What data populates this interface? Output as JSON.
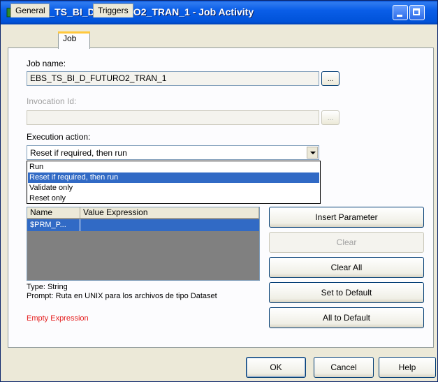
{
  "window": {
    "title": "JOBT_TS_BI_D_FUTURO2_TRAN_1 - Job Activity"
  },
  "tabs": [
    {
      "label": "General"
    },
    {
      "label": "Job"
    },
    {
      "label": "Triggers"
    }
  ],
  "job_name": {
    "label": "Job name:",
    "value": "EBS_TS_BI_D_FUTURO2_TRAN_1",
    "browse_label": "..."
  },
  "invocation": {
    "label": "Invocation Id:",
    "value": "",
    "browse_label": "..."
  },
  "execution": {
    "label": "Execution action:",
    "selected": "Reset if required, then run",
    "options": [
      "Run",
      "Reset if required, then run",
      "Validate only",
      "Reset only"
    ]
  },
  "parameters": {
    "columns": [
      "Name",
      "Value Expression"
    ],
    "rows": [
      {
        "name": "$PRM_P...",
        "value": ""
      }
    ]
  },
  "param_info": {
    "type": "Type: String",
    "prompt": "Prompt: Ruta en UNIX para los archivos de tipo Dataset",
    "error": "Empty Expression"
  },
  "side_buttons": {
    "insert": "Insert Parameter",
    "clear": "Clear",
    "clear_all": "Clear All",
    "set_default": "Set to Default",
    "all_default": "All to Default"
  },
  "footer": {
    "ok": "OK",
    "cancel": "Cancel",
    "help": "Help"
  },
  "colors": {
    "titlebar": "#0a5ee8",
    "selection": "#316ac5",
    "error": "#e52020",
    "window_bg": "#ece9d8"
  }
}
